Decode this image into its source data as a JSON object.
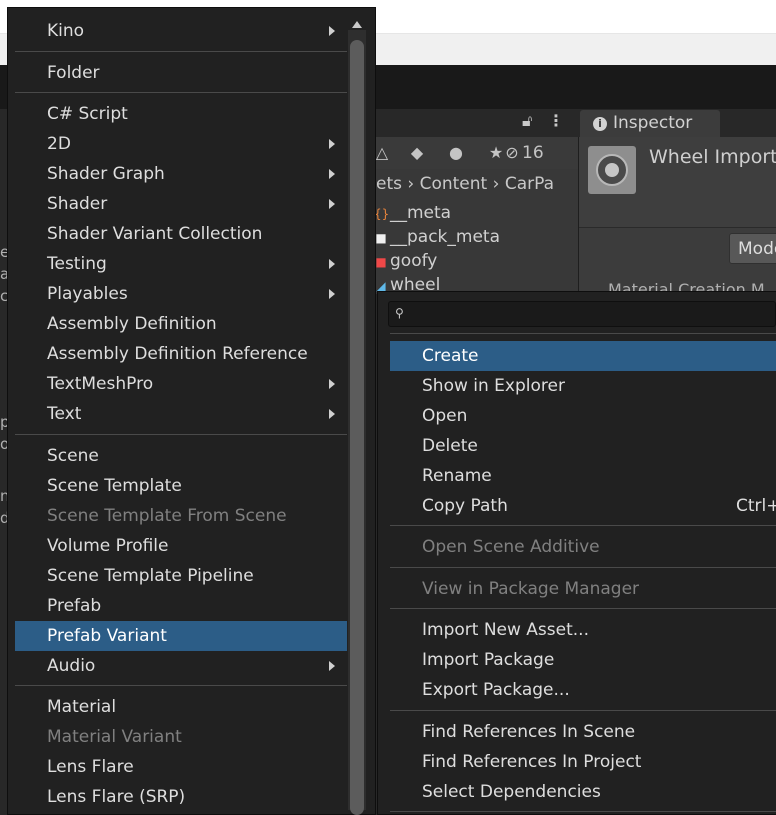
{
  "project": {
    "hidden_count": "16",
    "breadcrumb": [
      "ets",
      "Content",
      "CarPa"
    ],
    "files": [
      {
        "name": "__meta",
        "icon": "json-file-icon"
      },
      {
        "name": "__pack_meta",
        "icon": "document-icon"
      },
      {
        "name": "goofy",
        "icon": "material-icon"
      },
      {
        "name": "wheel",
        "icon": "model-icon"
      }
    ]
  },
  "inspector": {
    "tab_label": "Inspector",
    "title": "Wheel Import",
    "model_button": "Mode",
    "cut_text": "Material Creation M"
  },
  "left_edge": [
    "e",
    "a",
    "c",
    "p",
    "o",
    "n",
    "d"
  ],
  "create_menu": {
    "items": [
      {
        "label": "Kino",
        "submenu": true
      },
      {
        "label": "Folder"
      },
      {
        "label": "C# Script"
      },
      {
        "label": "2D",
        "submenu": true
      },
      {
        "label": "Shader Graph",
        "submenu": true
      },
      {
        "label": "Shader",
        "submenu": true
      },
      {
        "label": "Shader Variant Collection"
      },
      {
        "label": "Testing",
        "submenu": true
      },
      {
        "label": "Playables",
        "submenu": true
      },
      {
        "label": "Assembly Definition"
      },
      {
        "label": "Assembly Definition Reference"
      },
      {
        "label": "TextMeshPro",
        "submenu": true
      },
      {
        "label": "Text",
        "submenu": true
      },
      {
        "label": "Scene"
      },
      {
        "label": "Scene Template"
      },
      {
        "label": "Scene Template From Scene",
        "disabled": true
      },
      {
        "label": "Volume Profile"
      },
      {
        "label": "Scene Template Pipeline"
      },
      {
        "label": "Prefab"
      },
      {
        "label": "Prefab Variant",
        "selected": true
      },
      {
        "label": "Audio",
        "submenu": true
      },
      {
        "label": "Material"
      },
      {
        "label": "Material Variant",
        "disabled": true
      },
      {
        "label": "Lens Flare"
      },
      {
        "label": "Lens Flare (SRP)"
      }
    ]
  },
  "context_menu": {
    "items": [
      {
        "label": "Create",
        "selected": true
      },
      {
        "label": "Show in Explorer"
      },
      {
        "label": "Open"
      },
      {
        "label": "Delete"
      },
      {
        "label": "Rename"
      },
      {
        "label": "Copy Path",
        "shortcut": "Ctrl+A"
      },
      {
        "label": "Open Scene Additive",
        "disabled": true
      },
      {
        "label": "View in Package Manager",
        "disabled": true
      },
      {
        "label": "Import New Asset..."
      },
      {
        "label": "Import Package"
      },
      {
        "label": "Export Package..."
      },
      {
        "label": "Find References In Scene"
      },
      {
        "label": "Find References In Project"
      },
      {
        "label": "Select Dependencies"
      }
    ]
  },
  "colors": {
    "selection": "#2c5d87",
    "menu_bg": "#212121",
    "disabled_text": "#808080"
  }
}
